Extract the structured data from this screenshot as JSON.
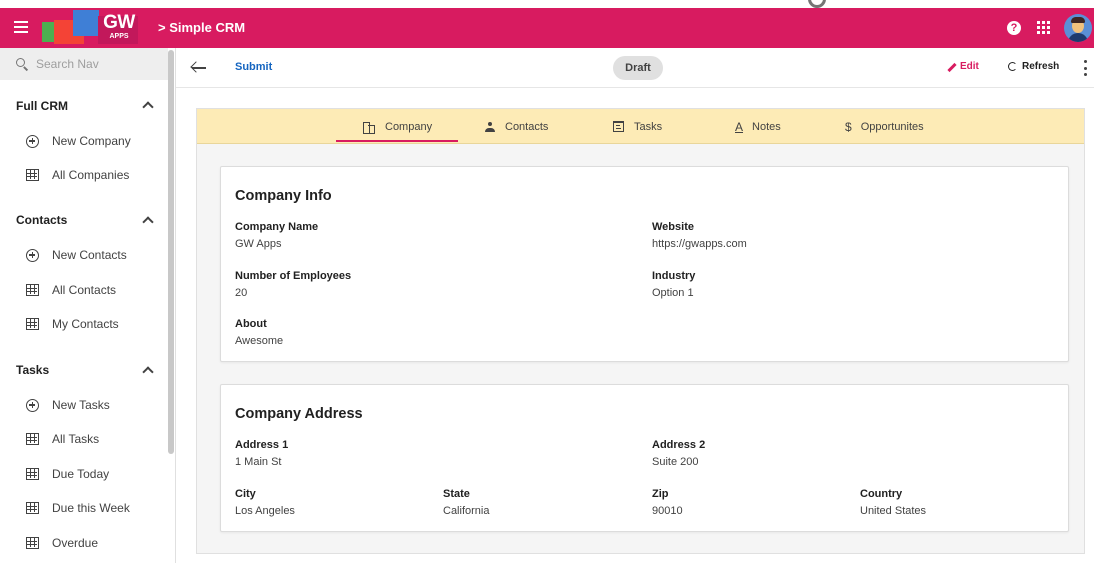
{
  "header": {
    "logo_text": "GW",
    "logo_subtext": "APPS",
    "app_title": "> Simple CRM",
    "help_label": "?",
    "brand_color": "#d81b60"
  },
  "sidebar": {
    "search_placeholder": "Search Nav",
    "sections": [
      {
        "title": "Full CRM",
        "items": [
          {
            "label": "New Company",
            "icon": "add-circle-icon"
          },
          {
            "label": "All Companies",
            "icon": "table-icon"
          }
        ]
      },
      {
        "title": "Contacts",
        "items": [
          {
            "label": "New Contacts",
            "icon": "add-circle-icon"
          },
          {
            "label": "All Contacts",
            "icon": "table-icon"
          },
          {
            "label": "My Contacts",
            "icon": "table-icon"
          }
        ]
      },
      {
        "title": "Tasks",
        "items": [
          {
            "label": "New Tasks",
            "icon": "add-circle-icon"
          },
          {
            "label": "All Tasks",
            "icon": "table-icon"
          },
          {
            "label": "Due Today",
            "icon": "table-icon"
          },
          {
            "label": "Due this Week",
            "icon": "table-icon"
          },
          {
            "label": "Overdue",
            "icon": "table-icon"
          }
        ]
      }
    ]
  },
  "actionbar": {
    "submit_label": "Submit",
    "status": "Draft",
    "edit_label": "Edit",
    "refresh_label": "Refresh"
  },
  "tabs": [
    {
      "label": "Company",
      "icon": "building-icon",
      "active": true
    },
    {
      "label": "Contacts",
      "icon": "person-icon"
    },
    {
      "label": "Tasks",
      "icon": "calendar-icon"
    },
    {
      "label": "Notes",
      "icon": "notes-icon"
    },
    {
      "label": "Opportunites",
      "icon": "dollar-icon"
    }
  ],
  "company_info": {
    "title": "Company Info",
    "company_name_label": "Company Name",
    "company_name": "GW Apps",
    "website_label": "Website",
    "website": "https://gwapps.com",
    "employees_label": "Number of Employees",
    "employees": "20",
    "industry_label": "Industry",
    "industry": "Option 1",
    "about_label": "About",
    "about": "Awesome"
  },
  "company_address": {
    "title": "Company Address",
    "address1_label": "Address 1",
    "address1": "1 Main St",
    "address2_label": "Address 2",
    "address2": "Suite 200",
    "city_label": "City",
    "city": "Los Angeles",
    "state_label": "State",
    "state": "California",
    "zip_label": "Zip",
    "zip": "90010",
    "country_label": "Country",
    "country": "United States"
  }
}
